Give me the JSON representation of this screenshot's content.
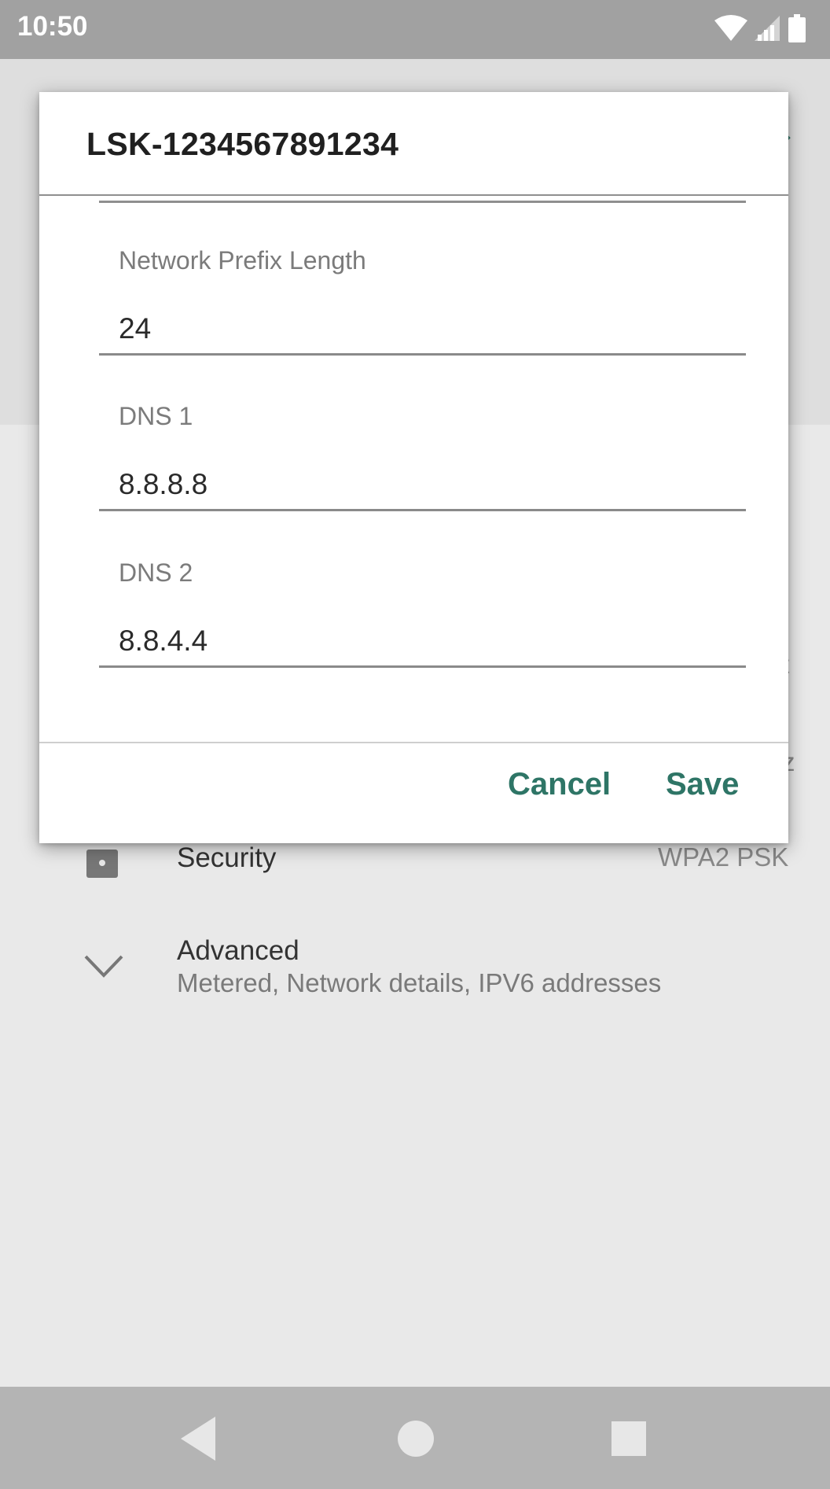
{
  "status_bar": {
    "time": "10:50"
  },
  "background": {
    "security_label": "Security",
    "security_value": "WPA2 PSK",
    "advanced_label": "Advanced",
    "advanced_sub": "Metered, Network details, IPV6 addresses",
    "clipped_right_1": "t",
    "clipped_right_2": "z"
  },
  "dialog": {
    "title": "LSK-1234567891234",
    "fields": [
      {
        "label": "Network Prefix Length",
        "value": "24"
      },
      {
        "label": "DNS 1",
        "value": "8.8.8.8"
      },
      {
        "label": "DNS 2",
        "value": "8.8.4.4"
      }
    ],
    "cancel_label": "Cancel",
    "save_label": "Save"
  },
  "colors": {
    "accent": "#2e7566",
    "status_bar": "#a1a1a1",
    "nav_bar": "#b4b4b4",
    "scrim_bg": "#e9e9e9"
  }
}
